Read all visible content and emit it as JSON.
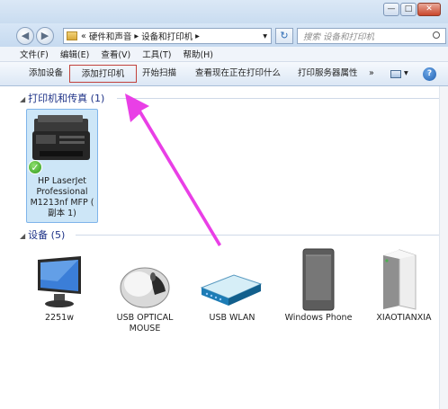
{
  "window": {
    "min": "—",
    "max": "□",
    "close": "✕"
  },
  "address": {
    "back": "◀",
    "forward": "▶",
    "crumbs": [
      "«",
      "硬件和声音",
      "▸",
      "设备和打印机",
      "▸"
    ],
    "dropdown": "▾",
    "refresh": "↻",
    "search_placeholder": "搜索 设备和打印机"
  },
  "menu": [
    "文件(F)",
    "编辑(E)",
    "查看(V)",
    "工具(T)",
    "帮助(H)"
  ],
  "toolbar": {
    "items": [
      "添加设备",
      "添加打印机",
      "开始扫描",
      "查看现在正在打印什么",
      "打印服务器属性",
      "»"
    ],
    "view_icon": "view-icon",
    "view_arrow": "▾",
    "help": "?"
  },
  "groups": {
    "printers": {
      "arrow": "◢",
      "title": "打印机和传真 (1)"
    },
    "devices": {
      "arrow": "◢",
      "title": "设备 (5)"
    }
  },
  "printer": {
    "label_lines": [
      "HP LaserJet",
      "Professional",
      "M1213nf MFP (",
      "副本 1)"
    ],
    "default_check": "✓"
  },
  "devices": [
    {
      "icon": "monitor-icon",
      "label_lines": [
        "2251w"
      ]
    },
    {
      "icon": "mouse-icon",
      "label_lines": [
        "USB OPTICAL",
        "MOUSE"
      ]
    },
    {
      "icon": "router-icon",
      "label_lines": [
        "USB WLAN"
      ]
    },
    {
      "icon": "phone-icon",
      "label_lines": [
        "Windows Phone"
      ]
    },
    {
      "icon": "drive-icon",
      "label_lines": [
        "XIAOTIANXIA"
      ]
    }
  ],
  "colors": {
    "annotation_arrow": "#e93fe6",
    "highlight_box": "#c2413b",
    "group_title": "#1e3287"
  }
}
